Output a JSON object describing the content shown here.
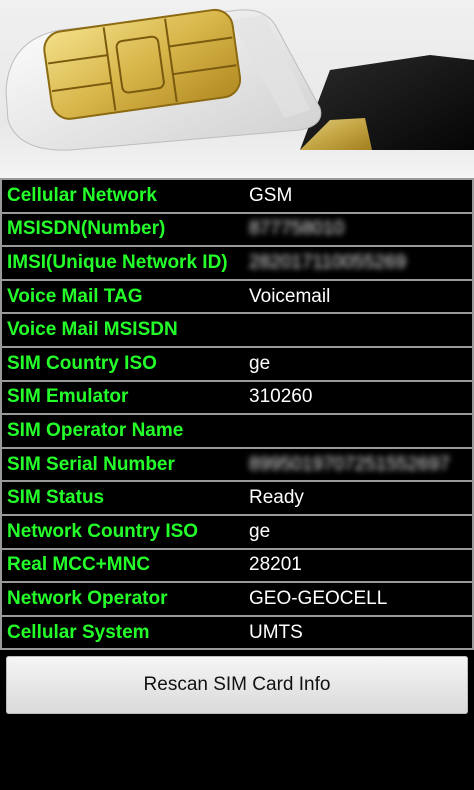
{
  "rows": [
    {
      "label": "Cellular Network",
      "value": "GSM"
    },
    {
      "label": "MSISDN(Number)",
      "value": "877758010"
    },
    {
      "label": "IMSI(Unique Network ID)",
      "value": "282017110055269"
    },
    {
      "label": "Voice Mail TAG",
      "value": "Voicemail"
    },
    {
      "label": "Voice Mail MSISDN",
      "value": ""
    },
    {
      "label": "SIM Country ISO",
      "value": "ge"
    },
    {
      "label": "SIM Emulator",
      "value": "310260"
    },
    {
      "label": "SIM Operator Name",
      "value": ""
    },
    {
      "label": "SIM Serial Number",
      "value": "8995019707251552697"
    },
    {
      "label": "SIM Status",
      "value": "Ready"
    },
    {
      "label": "Network Country ISO",
      "value": "ge"
    },
    {
      "label": "Real MCC+MNC",
      "value": "28201"
    },
    {
      "label": "Network Operator",
      "value": "GEO-GEOCELL"
    },
    {
      "label": "Cellular System",
      "value": "UMTS"
    }
  ],
  "button": {
    "label": "Rescan SIM Card Info"
  },
  "colors": {
    "label_green": "#24ff2a",
    "background": "#000000",
    "separator": "#9a9a9a"
  },
  "icons": {
    "header_image": "sim-card-icon"
  }
}
